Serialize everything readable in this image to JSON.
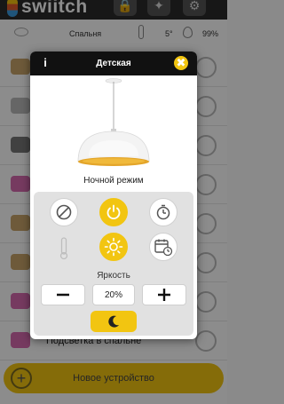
{
  "app": {
    "logo_text": "swiitch"
  },
  "status": {
    "room": "Спальня",
    "temperature": "5°",
    "humidity": "99%"
  },
  "background_list": {
    "visible_label": "Подсветка в спальне"
  },
  "add_device": {
    "label": "Новое устройство"
  },
  "modal": {
    "info_label": "i",
    "title": "Детская",
    "close_label": "✖",
    "mode_label": "Ночной режим",
    "brightness_label": "Яркость",
    "brightness_value": "20%",
    "selected_action": "power"
  },
  "colors": {
    "accent": "#f2c511",
    "header": "#111111",
    "panel": "#e1e1e1"
  },
  "icons": {
    "info": "info-icon",
    "close": "close-icon",
    "disable": "disable-icon",
    "power": "power-icon",
    "timer": "stopwatch-icon",
    "thermometer": "thermometer-icon",
    "brightness": "sun-icon",
    "schedule": "calendar-clock-icon",
    "minus": "minus-icon",
    "plus": "plus-icon",
    "night": "moon-icon"
  }
}
